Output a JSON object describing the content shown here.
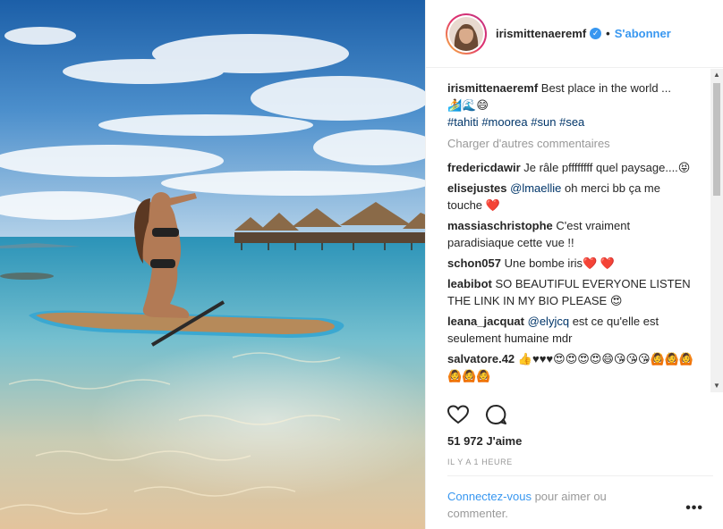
{
  "header": {
    "username": "irismittenaeremf",
    "separator": "•",
    "follow_label": "S'abonner",
    "verified_icon": "verified-badge-icon"
  },
  "caption": {
    "username": "irismittenaeremf",
    "text": "Best place in the world ...",
    "emojis": "🏄🌊😄",
    "hashtags": [
      "#tahiti",
      "#moorea",
      "#sun",
      "#sea"
    ]
  },
  "load_more_label": "Charger d'autres commentaires",
  "comments": [
    {
      "user": "fredericdawir",
      "text": "Je râle pffffffff quel paysage....😝"
    },
    {
      "user": "elisejustes",
      "mention": "@lmaellie",
      "text": "oh merci bb ça me touche ❤️"
    },
    {
      "user": "massiaschristophe",
      "text": "C'est vraiment paradisiaque cette vue !!"
    },
    {
      "user": "schon057",
      "text": "Une bombe iris❤️ ❤️"
    },
    {
      "user": "leabibot",
      "text": "SO BEAUTIFUL EVERYONE LISTEN THE LINK IN MY BIO PLEASE 😍"
    },
    {
      "user": "leana_jacquat",
      "mention": "@elyjcq",
      "text": "est ce qu'elle est seulement humaine mdr"
    },
    {
      "user": "salvatore.42",
      "text": "👍♥♥♥😍😍😍😍😄😘😘😘🙆🙆🙆🙆🙆🙆"
    }
  ],
  "actions": {
    "like_icon": "heart-icon",
    "comment_icon": "comment-icon"
  },
  "likes_label": "51 972 J'aime",
  "timestamp": "IL Y A 1 HEURE",
  "login": {
    "link": "Connectez-vous",
    "text": "pour aimer ou commenter."
  },
  "more_label": "•••",
  "colors": {
    "accent": "#3897f0",
    "text": "#262626",
    "muted": "#999999",
    "hashtag": "#003569",
    "sea": "#3aa6c9",
    "sand": "#e6c9a0"
  }
}
